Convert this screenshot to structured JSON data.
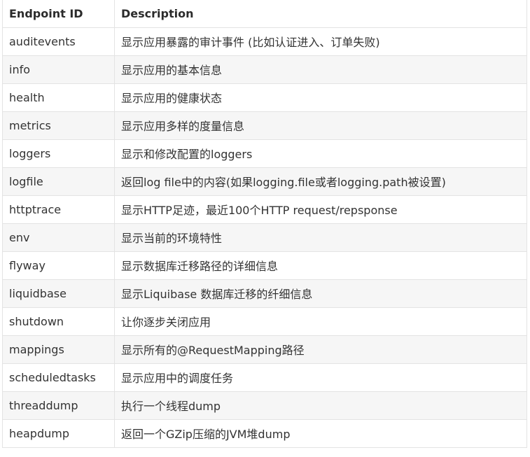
{
  "table": {
    "headers": [
      "Endpoint ID",
      "Description"
    ],
    "rows": [
      [
        "auditevents",
        "显示应用暴露的审计事件 (比如认证进入、订单失败)"
      ],
      [
        "info",
        "显示应用的基本信息"
      ],
      [
        "health",
        "显示应用的健康状态"
      ],
      [
        "metrics",
        "显示应用多样的度量信息"
      ],
      [
        "loggers",
        "显示和修改配置的loggers"
      ],
      [
        "logfile",
        "返回log file中的内容(如果logging.file或者logging.path被设置)"
      ],
      [
        "httptrace",
        "显示HTTP足迹，最近100个HTTP request/repsponse"
      ],
      [
        "env",
        "显示当前的环境特性"
      ],
      [
        "flyway",
        "显示数据库迁移路径的详细信息"
      ],
      [
        "liquidbase",
        "显示Liquibase 数据库迁移的纤细信息"
      ],
      [
        "shutdown",
        "让你逐步关闭应用"
      ],
      [
        "mappings",
        "显示所有的@RequestMapping路径"
      ],
      [
        "scheduledtasks",
        "显示应用中的调度任务"
      ],
      [
        "threaddump",
        "执行一个线程dump"
      ],
      [
        "heapdump",
        "返回一个GZip压缩的JVM堆dump"
      ]
    ]
  }
}
